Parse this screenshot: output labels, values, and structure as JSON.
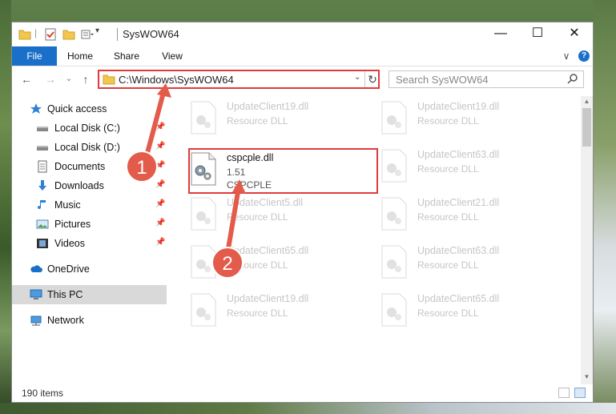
{
  "window": {
    "title": "SysWOW64",
    "controls": {
      "minimize": "—",
      "maximize": "☐",
      "close": "✕"
    }
  },
  "ribbon": {
    "tabs": [
      "File",
      "Home",
      "Share",
      "View"
    ],
    "help": "?",
    "expand": "∨"
  },
  "nav": {
    "back": "←",
    "forward": "→",
    "recent": "⌄",
    "up": "↑",
    "address": "C:\\Windows\\SysWOW64",
    "address_dropdown": "⌄",
    "refresh": "↻",
    "search_placeholder": "Search SysWOW64"
  },
  "sidebar": {
    "items": [
      {
        "label": "Quick access",
        "icon": "star-icon"
      },
      {
        "label": "Local Disk (C:)",
        "icon": "drive-icon",
        "pinned": true
      },
      {
        "label": "Local Disk (D:)",
        "icon": "drive-icon",
        "pinned": true
      },
      {
        "label": "Documents",
        "icon": "documents-icon",
        "pinned": true
      },
      {
        "label": "Downloads",
        "icon": "downloads-icon",
        "pinned": true
      },
      {
        "label": "Music",
        "icon": "music-icon",
        "pinned": true
      },
      {
        "label": "Pictures",
        "icon": "pictures-icon",
        "pinned": true
      },
      {
        "label": "Videos",
        "icon": "videos-icon",
        "pinned": true
      },
      {
        "label": "OneDrive",
        "icon": "cloud-icon"
      },
      {
        "label": "This PC",
        "icon": "computer-icon",
        "selected": true
      },
      {
        "label": "Network",
        "icon": "network-icon"
      }
    ]
  },
  "files": [
    {
      "name": "UpdateClient19.dll",
      "desc": "Resource DLL",
      "blurred": true
    },
    {
      "name": "UpdateClient19.dll",
      "desc": "Resource DLL",
      "blurred": true
    },
    {
      "name": "cspcple.dll",
      "desc": "1.51",
      "desc2": "CSPCPLE",
      "blurred": false
    },
    {
      "name": "UpdateClient63.dll",
      "desc": "Resource DLL",
      "blurred": true
    },
    {
      "name": "UpdateClient5.dll",
      "desc": "Resource DLL",
      "blurred": true
    },
    {
      "name": "UpdateClient21.dll",
      "desc": "Resource DLL",
      "blurred": true
    },
    {
      "name": "UpdateClient65.dll",
      "desc": "Resource DLL",
      "blurred": true
    },
    {
      "name": "UpdateClient63.dll",
      "desc": "Resource DLL",
      "blurred": true
    },
    {
      "name": "UpdateClient19.dll",
      "desc": "Resource DLL",
      "blurred": true
    },
    {
      "name": "UpdateClient65.dll",
      "desc": "Resource DLL",
      "blurred": true
    }
  ],
  "status": {
    "item_count": "190 items"
  },
  "annotations": {
    "step1": "1",
    "step2": "2",
    "color": "#e03b3b"
  }
}
